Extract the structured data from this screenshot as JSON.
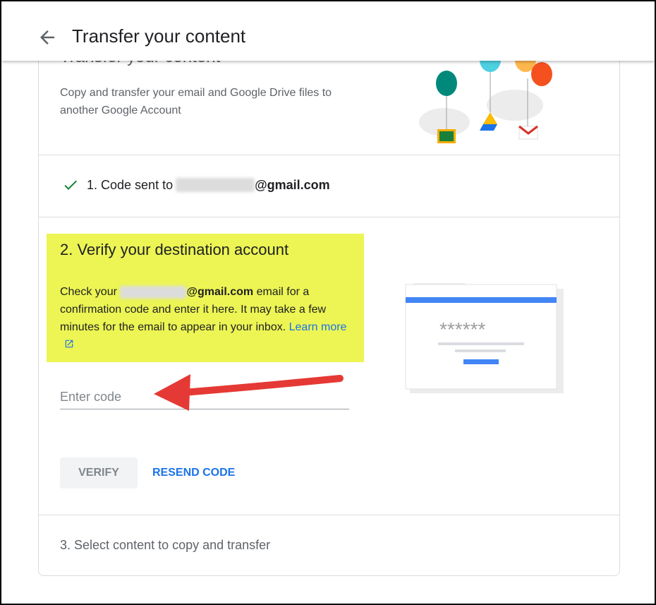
{
  "header": {
    "title": "Transfer your content",
    "back_icon": "arrow-back-icon"
  },
  "intro": {
    "faded_title": "Transfer your content",
    "description": "Copy and transfer your email and Google Drive files to another Google Account"
  },
  "step1": {
    "label": "1. Code sent to",
    "email_domain": "@gmail.com"
  },
  "step2": {
    "title": "2. Verify your destination account",
    "body_prefix": "Check your",
    "email_domain": "@gmail.com",
    "body_suffix": "email for a confirmation code and enter it here. It may take a few minutes for the email to appear in your inbox.",
    "learn_more": "Learn more"
  },
  "code_input": {
    "placeholder": "Enter code",
    "value": ""
  },
  "buttons": {
    "verify": "VERIFY",
    "resend": "RESEND CODE"
  },
  "step3": {
    "label": "3. Select content to copy and transfer"
  },
  "illustration": {
    "masked_code": "******"
  },
  "colors": {
    "highlight": "#ecf553",
    "accent": "#1a73e8",
    "check": "#188038",
    "arrow": "#e53935"
  }
}
